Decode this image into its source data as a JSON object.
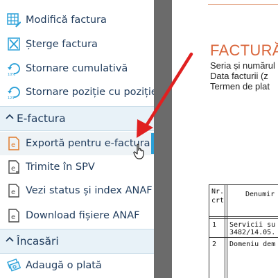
{
  "sidebar": {
    "items_top": [
      {
        "label": "Modifică factura",
        "icon": "table-edit-icon"
      },
      {
        "label": "Șterge factura",
        "icon": "delete-x-icon"
      },
      {
        "label": "Stornare cumulativă",
        "icon": "storno-cumulative-icon"
      },
      {
        "label": "Stornare poziție cu poziție",
        "icon": "storno-position-icon"
      }
    ],
    "section_efactura": "E-factura",
    "items_efactura": [
      {
        "label": "Exportă pentru e-factura",
        "icon": "export-e-document-icon"
      },
      {
        "label": "Trimite în SPV",
        "icon": "send-e-document-icon"
      },
      {
        "label": "Vezi status și index ANAF",
        "icon": "status-e-document-icon"
      },
      {
        "label": "Download fișiere ANAF",
        "icon": "download-e-document-icon"
      }
    ],
    "section_incasari": "Încasări",
    "items_incasari": [
      {
        "label": "Adaugă o plată",
        "icon": "add-payment-icon"
      }
    ]
  },
  "document": {
    "title": "FACTURĂ",
    "lines": [
      "Seria și numărul",
      "Data facturii (z",
      "Termen de plat"
    ],
    "table": {
      "header_nr": [
        "Nr.",
        "crt"
      ],
      "header_denumire": "Denumir",
      "rows": [
        {
          "nr": "1",
          "text": [
            "Servicii su",
            "3482/14.05."
          ]
        },
        {
          "nr": "2",
          "text": [
            "Domeniu dem"
          ]
        }
      ]
    }
  },
  "colors": {
    "accent": "#2aa0d8",
    "arrow": "#e02020",
    "title": "#d9653a",
    "divider": "#6b6b6b"
  }
}
